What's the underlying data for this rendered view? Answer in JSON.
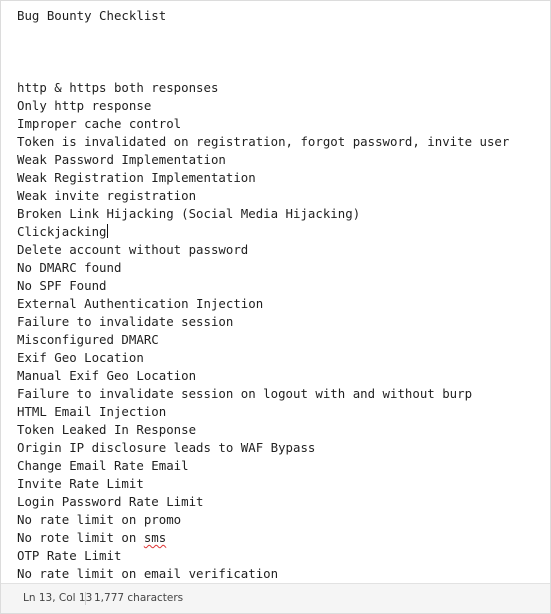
{
  "editor": {
    "title_line": "Bug Bounty Checklist",
    "caret_after_item": 8,
    "items": [
      "http & https both responses",
      "Only http response",
      "Improper cache control",
      "Token is invalidated on registration, forgot password, invite user",
      "Weak Password Implementation",
      "Weak Registration Implementation",
      "Weak invite registration",
      "Broken Link Hijacking (Social Media Hijacking)",
      "Clickjacking",
      "Delete account without password",
      "No DMARC found",
      "No SPF Found",
      "External Authentication Injection",
      "Failure to invalidate session",
      "Misconfigured DMARC",
      "Exif Geo Location",
      "Manual Exif Geo Location",
      "Failure to invalidate session on logout with and without burp",
      "HTML Email Injection",
      "Token Leaked In Response",
      "Origin IP disclosure leads to WAF Bypass",
      "Change Email Rate Email",
      "Invite Rate Limit",
      "Login Password Rate Limit",
      "No rate limit on promo",
      "No rote limit on sms",
      "OTP Rate Limit",
      "No rate limit on email verification"
    ]
  },
  "status": {
    "position": "Ln 13, Col 13",
    "characters": "1,777 characters"
  }
}
